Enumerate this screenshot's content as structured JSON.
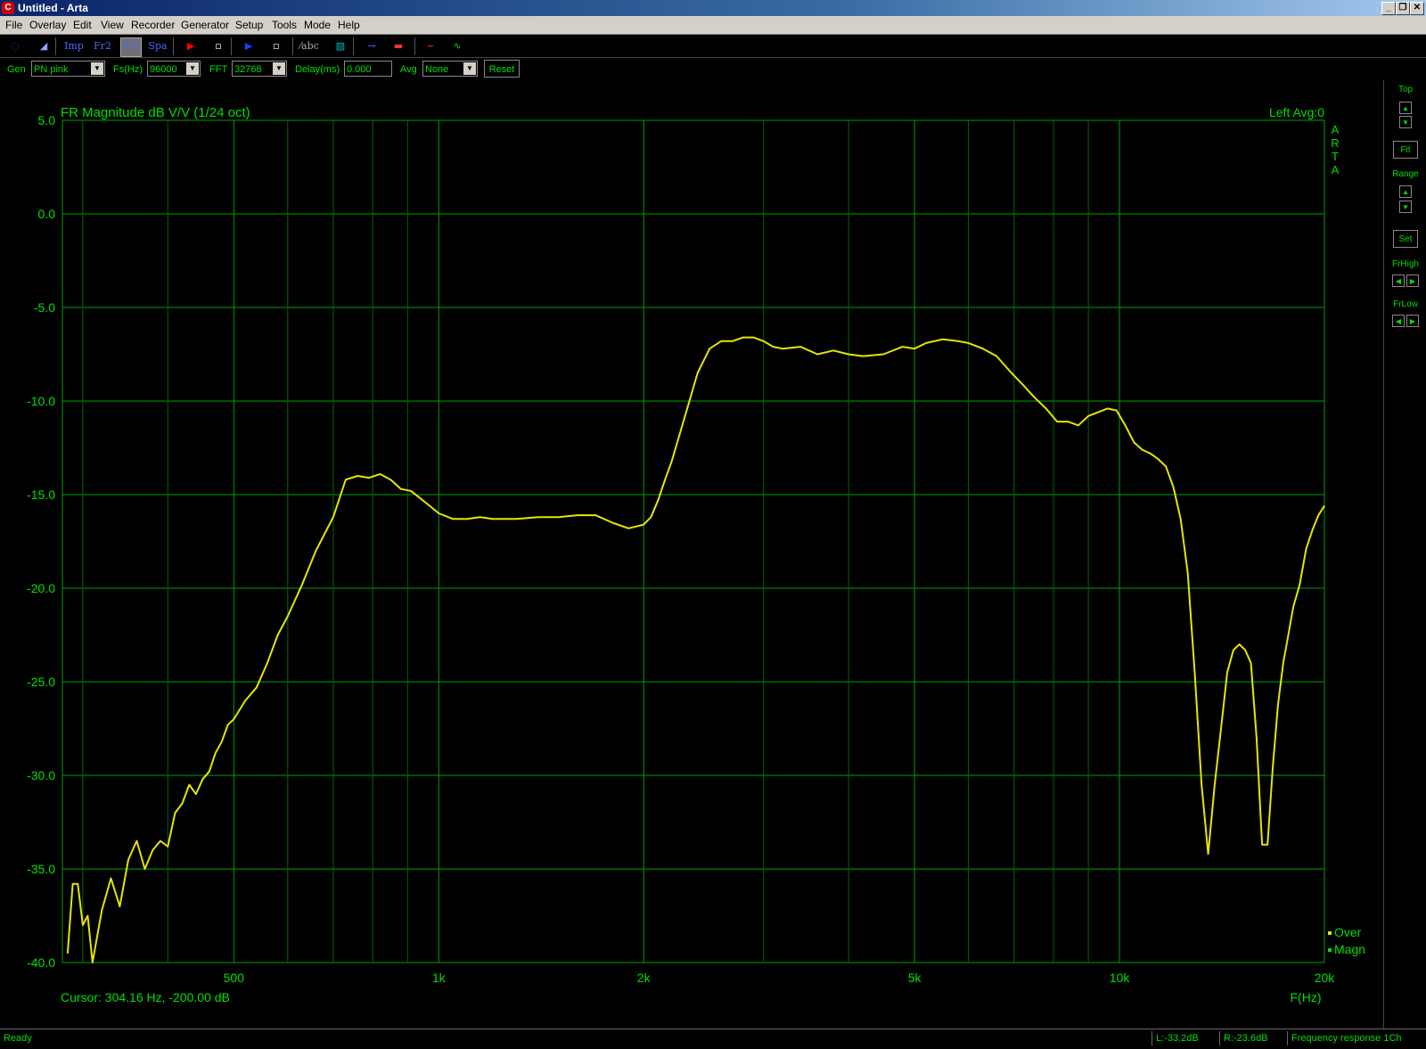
{
  "window": {
    "title": "Untitled - Arta",
    "buttons": [
      "_",
      "❐",
      "✕"
    ]
  },
  "menu": [
    "File",
    "Overlay",
    "Edit",
    "View",
    "Recorder",
    "Generator",
    "Setup",
    "Tools",
    "Mode",
    "Help"
  ],
  "toolbar": {
    "buttons": [
      {
        "name": "new-icon",
        "glyph": "◌",
        "color": "#1a3fff"
      },
      {
        "name": "open-icon",
        "glyph": "◢",
        "color": "#8fa0ff"
      },
      {
        "name": "imp-mode-button",
        "glyph": "Imp",
        "color": "#4a6bff"
      },
      {
        "name": "fr2-mode-button",
        "glyph": "Fr2",
        "color": "#4a6bff"
      },
      {
        "name": "fr1-mode-button",
        "glyph": "Fr1",
        "color": "#4a6bff"
      },
      {
        "name": "spa-mode-button",
        "glyph": "Spa",
        "color": "#4a6bff"
      },
      {
        "name": "record-icon",
        "glyph": "▶",
        "color": "#ff0000"
      },
      {
        "name": "stop-icon",
        "glyph": "▫",
        "color": "#ffffff"
      },
      {
        "name": "play-icon",
        "glyph": "▶",
        "color": "#1a3fff"
      },
      {
        "name": "pause-icon",
        "glyph": "▫",
        "color": "#ffffff"
      },
      {
        "name": "abc-icon",
        "glyph": "⁄abc",
        "color": "#aaaaaa"
      },
      {
        "name": "grid-icon",
        "glyph": "▧",
        "color": "#00c0c0"
      },
      {
        "name": "arrow-icon",
        "glyph": "→",
        "color": "#4a6bff"
      },
      {
        "name": "color-icon",
        "glyph": "▬",
        "color": "#ff3030"
      },
      {
        "name": "generator-icon",
        "glyph": "~",
        "color": "#ff3030"
      },
      {
        "name": "signal-icon",
        "glyph": "∿",
        "color": "#00e000"
      }
    ]
  },
  "controls": {
    "gen_label": "Gen",
    "gen_value": "PN pink",
    "fs_label": "Fs(Hz)",
    "fs_value": "96000",
    "fft_label": "FFT",
    "fft_value": "32768",
    "delay_label": "Delay(ms)",
    "delay_value": "0.000",
    "avg_label": "Avg",
    "avg_value": "None",
    "reset_label": "Reset"
  },
  "plot": {
    "title": "FR Magnitude dB V/V (1/24 oct)",
    "channel_info": "Left  Avg:0",
    "side_label": "ARTA",
    "cursor": "Cursor: 304.16 Hz, -200.00 dB",
    "xaxis_label": "F(Hz)",
    "legend": [
      "Over",
      "Magn"
    ],
    "colors": {
      "grid": "#00a000",
      "axis_text": "#00e000",
      "curve": "#e6e600",
      "background": "#000000"
    }
  },
  "right_panel": {
    "top_label": "Top",
    "fit_label": "Fit",
    "range_label": "Range",
    "set_label": "Set",
    "frhigh_label": "FrHigh",
    "frlow_label": "FrLow"
  },
  "status": {
    "ready": "Ready",
    "left_level": "L:-33.2dB",
    "right_level": "R:-23.6dB",
    "mode": "Frequency response 1Ch"
  },
  "chart_data": {
    "type": "line",
    "title": "FR Magnitude dB V/V (1/24 oct)",
    "xlabel": "F(Hz)",
    "ylabel": "",
    "xscale": "log",
    "xlim": [
      280,
      20000
    ],
    "ylim": [
      -40,
      5
    ],
    "yticks": [
      5,
      0,
      -5,
      -10,
      -15,
      -20,
      -25,
      -30,
      -35,
      -40
    ],
    "ytick_labels": [
      "5.0",
      "0.0",
      "-5.0",
      "-10.0",
      "-15.0",
      "-20.0",
      "-25.0",
      "-30.0",
      "-35.0",
      "-40.0"
    ],
    "xticks": [
      500,
      1000,
      2000,
      5000,
      10000,
      20000
    ],
    "xtick_labels": [
      "500",
      "1k",
      "2k",
      "5k",
      "10k",
      "20k"
    ],
    "minor_xgrid": [
      300,
      400,
      600,
      700,
      800,
      900,
      3000,
      4000,
      6000,
      7000,
      8000,
      9000
    ],
    "grid": true,
    "legend_position": "bottom-right",
    "series": [
      {
        "name": "Magn",
        "x": [
          285,
          290,
          295,
          300,
          305,
          310,
          320,
          330,
          340,
          350,
          360,
          370,
          380,
          390,
          400,
          410,
          420,
          430,
          440,
          450,
          460,
          470,
          480,
          490,
          500,
          520,
          540,
          560,
          580,
          600,
          630,
          660,
          700,
          730,
          760,
          790,
          820,
          850,
          880,
          910,
          940,
          970,
          1000,
          1050,
          1100,
          1150,
          1200,
          1300,
          1400,
          1500,
          1600,
          1700,
          1800,
          1900,
          2000,
          2050,
          2100,
          2150,
          2200,
          2300,
          2400,
          2500,
          2600,
          2700,
          2800,
          2900,
          3000,
          3100,
          3200,
          3400,
          3600,
          3800,
          4000,
          4200,
          4500,
          4800,
          5000,
          5200,
          5500,
          5800,
          6000,
          6300,
          6600,
          6900,
          7200,
          7500,
          7800,
          8100,
          8400,
          8700,
          9000,
          9300,
          9600,
          9900,
          10200,
          10500,
          10800,
          11100,
          11400,
          11700,
          12000,
          12300,
          12600,
          12900,
          13200,
          13500,
          13800,
          14100,
          14400,
          14700,
          15000,
          15300,
          15600,
          15900,
          16200,
          16500,
          16800,
          17100,
          17400,
          17700,
          18000,
          18400,
          18800,
          19200,
          19600,
          20000
        ],
        "values": [
          -39.5,
          -35.8,
          -35.8,
          -38,
          -37.5,
          -40,
          -37.2,
          -35.5,
          -37,
          -34.5,
          -33.5,
          -35,
          -34,
          -33.5,
          -33.8,
          -32,
          -31.5,
          -30.5,
          -31,
          -30.2,
          -29.8,
          -28.8,
          -28.2,
          -27.3,
          -27,
          -26,
          -25.3,
          -24,
          -22.5,
          -21.5,
          -19.8,
          -18,
          -16.2,
          -14.2,
          -14,
          -14.1,
          -13.9,
          -14.2,
          -14.7,
          -14.8,
          -15.2,
          -15.6,
          -16,
          -16.3,
          -16.3,
          -16.2,
          -16.3,
          -16.3,
          -16.2,
          -16.2,
          -16.1,
          -16.1,
          -16.5,
          -16.8,
          -16.6,
          -16.2,
          -15.3,
          -14.2,
          -13.2,
          -10.8,
          -8.5,
          -7.2,
          -6.8,
          -6.8,
          -6.6,
          -6.6,
          -6.8,
          -7.1,
          -7.2,
          -7.1,
          -7.5,
          -7.3,
          -7.5,
          -7.6,
          -7.5,
          -7.1,
          -7.2,
          -6.9,
          -6.7,
          -6.8,
          -6.9,
          -7.2,
          -7.6,
          -8.4,
          -9.1,
          -9.8,
          -10.4,
          -11.1,
          -11.1,
          -11.3,
          -10.8,
          -10.6,
          -10.4,
          -10.5,
          -11.3,
          -12.2,
          -12.6,
          -12.8,
          -13.1,
          -13.5,
          -14.6,
          -16.3,
          -19.2,
          -24.5,
          -30.5,
          -34.2,
          -30.5,
          -27.5,
          -24.5,
          -23.3,
          -23,
          -23.3,
          -24,
          -28,
          -33.7,
          -33.7,
          -29.5,
          -26.2,
          -24,
          -22.5,
          -21,
          -19.8,
          -17.9,
          -16.9,
          -16.1,
          -15.6
        ]
      }
    ]
  }
}
